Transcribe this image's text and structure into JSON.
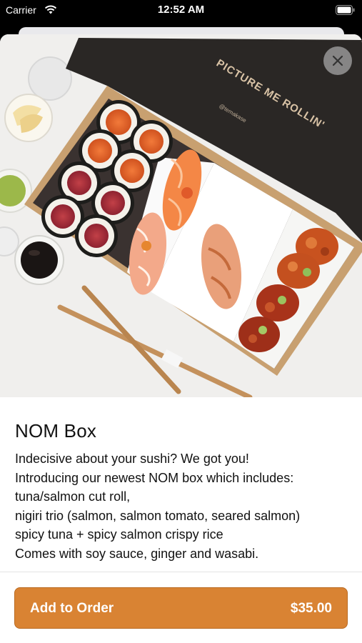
{
  "status_bar": {
    "carrier": "Carrier",
    "time": "12:52 AM"
  },
  "item": {
    "box_print": "PICTURE ME ROLLIN'",
    "box_handle": "@temakase",
    "title": "NOM Box",
    "description_lines": [
      "Indecisive about your sushi? We got you!",
      "Introducing our newest NOM box which includes:",
      "tuna/salmon cut roll,",
      "nigiri trio (salmon, salmon tomato, seared salmon)",
      "spicy tuna + spicy salmon crispy rice",
      "Comes with soy sauce, ginger and wasabi."
    ]
  },
  "actions": {
    "add_label": "Add to Order",
    "price": "$35.00"
  },
  "icons": {
    "close": "close-icon",
    "wifi": "wifi-icon",
    "battery": "battery-icon"
  },
  "colors": {
    "accent": "#d98333",
    "box": "#2a2725"
  }
}
